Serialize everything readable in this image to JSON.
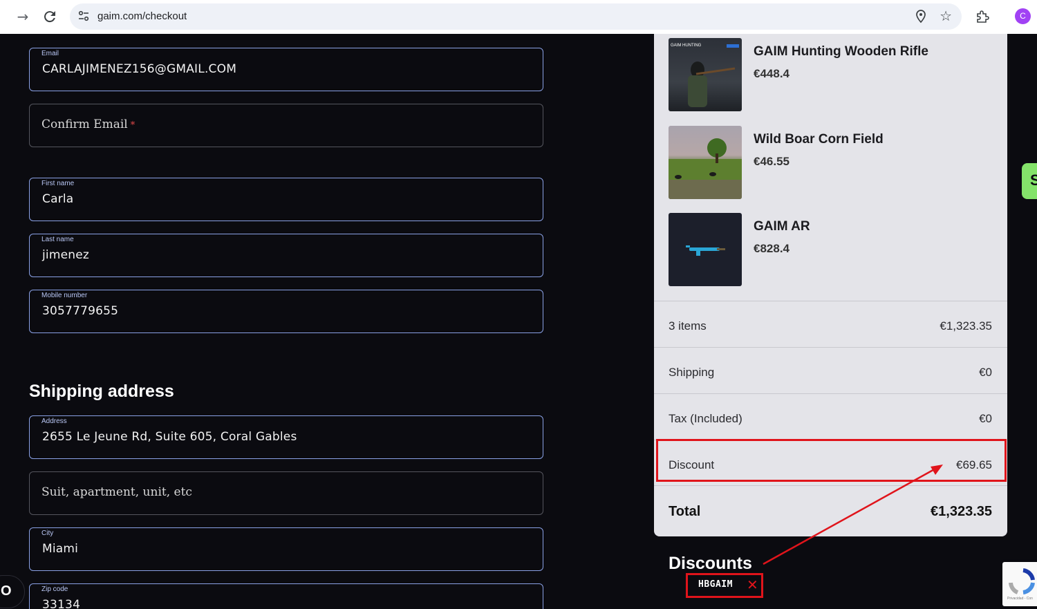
{
  "browser": {
    "url": "gaim.com/checkout",
    "avatar_letter": "C",
    "avatar_color": "#a142f4"
  },
  "form": {
    "email": {
      "label": "Email",
      "value": "CARLAJIMENEZ156@GMAIL.COM"
    },
    "confirm_email": {
      "placeholder": "Confirm Email",
      "required_mark": "*"
    },
    "first_name": {
      "label": "First name",
      "value": "Carla"
    },
    "last_name": {
      "label": "Last name",
      "value": "jimenez"
    },
    "mobile": {
      "label": "Mobile number",
      "value": "3057779655"
    },
    "shipping_title": "Shipping address",
    "address": {
      "label": "Address",
      "value": "2655 Le Jeune Rd, Suite 605, Coral Gables"
    },
    "address2": {
      "placeholder": "Suit, apartment, unit, etc"
    },
    "city": {
      "label": "City",
      "value": "Miami"
    },
    "zip": {
      "label": "Zip code",
      "value": "33134"
    }
  },
  "cart": {
    "products": [
      {
        "name": "GAIM Hunting Wooden Rifle",
        "price": "€448.4",
        "thumb_caption": "GAIM HUNTING"
      },
      {
        "name": "Wild Boar Corn Field",
        "price": "€46.55"
      },
      {
        "name": "GAIM AR",
        "price": "€828.4"
      }
    ],
    "items_label": "3 items",
    "items_value": "€1,323.35",
    "shipping_label": "Shipping",
    "shipping_value": "€0",
    "tax_label": "Tax (Included)",
    "tax_value": "€0",
    "discount_label": "Discount",
    "discount_value": "€69.65",
    "total_label": "Total",
    "total_value": "€1,323.35"
  },
  "discounts": {
    "title": "Discounts",
    "code": "HBGAIM"
  },
  "colors": {
    "accent_green": "#84e36a",
    "annotation_red": "#e0141b",
    "field_border": "#8aa1e6"
  }
}
